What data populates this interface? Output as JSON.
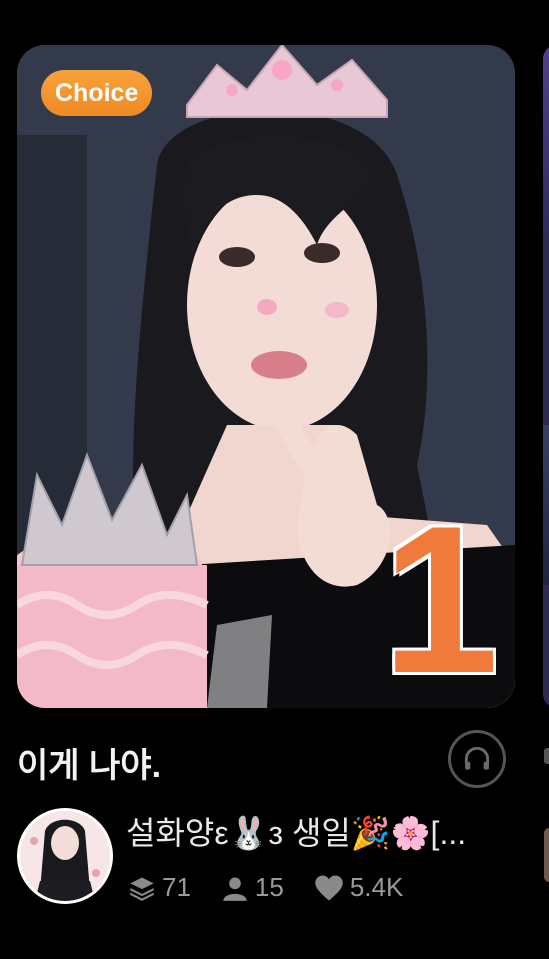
{
  "card": {
    "badge": "Choice",
    "rank": "1",
    "title": "이게 나야.",
    "author": "설화양ε🐰з 생일🎉🌸[...",
    "stats": {
      "tracks": "71",
      "followers": "15",
      "likes": "5.4K"
    }
  },
  "colors": {
    "badge": "#f39430",
    "rank": "#f07a3c",
    "stat_text": "#9a9a9a"
  },
  "icons": [
    "headphones-icon",
    "layers-icon",
    "person-icon",
    "heart-icon"
  ]
}
